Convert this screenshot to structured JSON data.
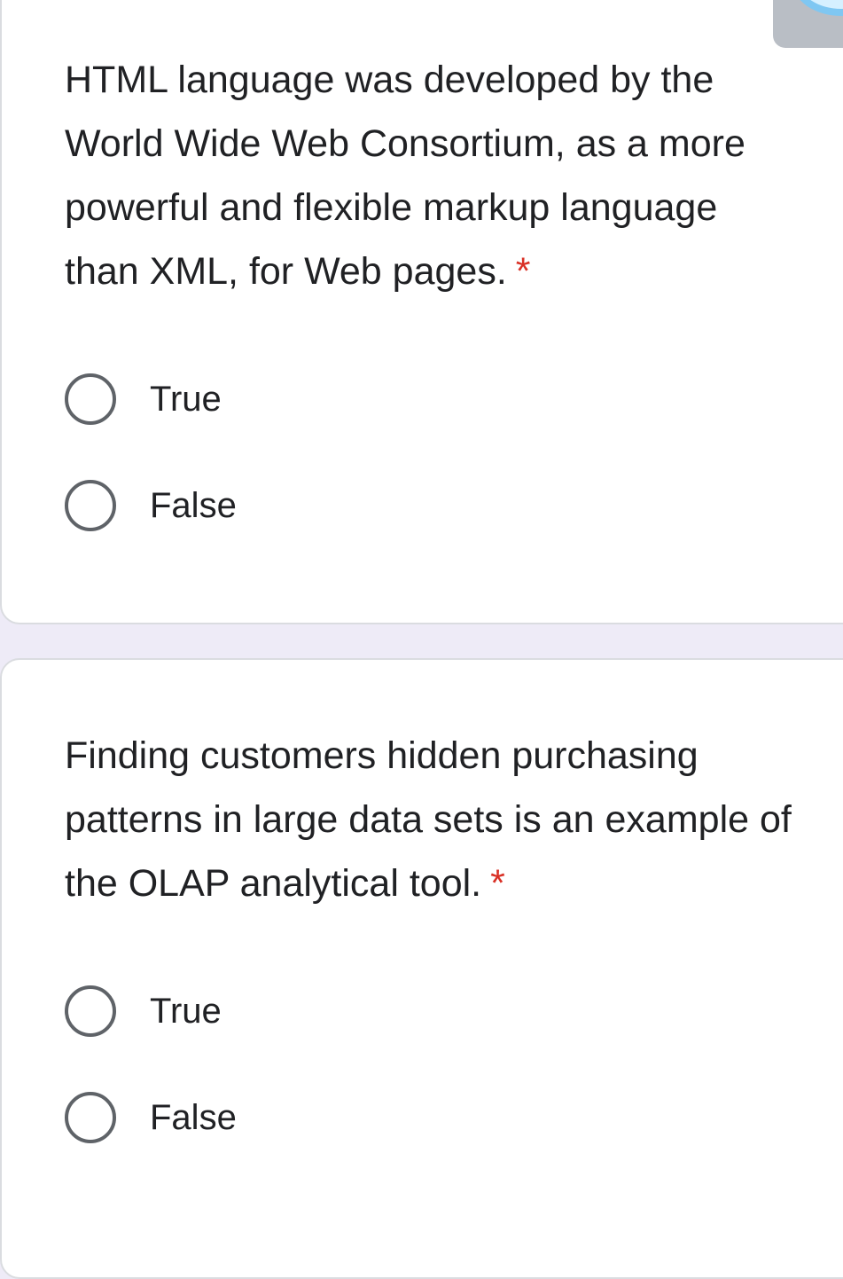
{
  "questions": [
    {
      "text": "HTML language was developed by the World Wide Web Consortium, as a more powerful and flexible markup language than XML, for Web pages.",
      "required_marker": "*",
      "options": [
        "True",
        "False"
      ]
    },
    {
      "text": "Finding customers hidden purchasing patterns in large data sets is an example of the OLAP analytical tool.",
      "required_marker": "*",
      "options": [
        "True",
        "False"
      ]
    }
  ],
  "colors": {
    "background": "#eeebf7",
    "card": "#ffffff",
    "required": "#d93025",
    "radio_border": "#5f6368",
    "text": "#202124"
  }
}
